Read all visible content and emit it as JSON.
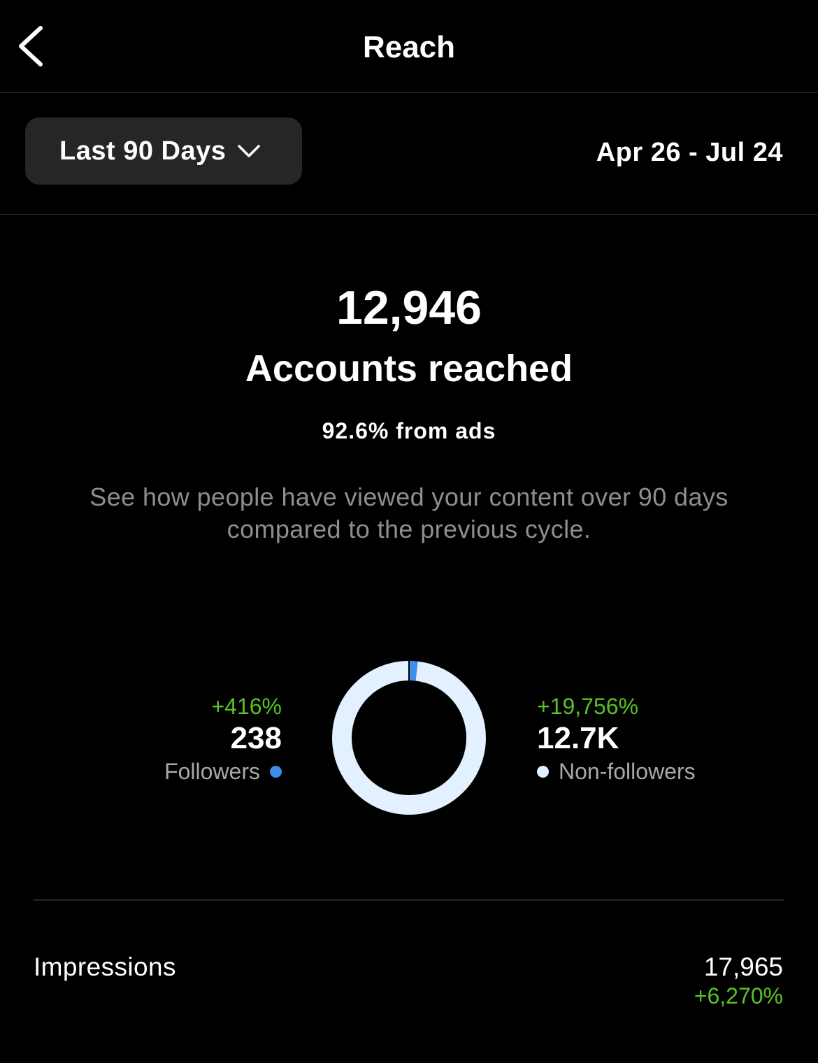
{
  "header": {
    "title": "Reach",
    "back_icon": "chevron-left-icon"
  },
  "range": {
    "selected": "Last 90 Days",
    "dropdown_icon": "chevron-down-icon",
    "dates": "Apr 26 - Jul 24"
  },
  "summary": {
    "total": "12,946",
    "label": "Accounts reached",
    "ads_share": "92.6% from ads",
    "description": "See how people have viewed your content over 90 days compared to the previous cycle."
  },
  "breakdown": {
    "followers": {
      "change": "+416%",
      "value": "238",
      "label": "Followers",
      "color": "#3b8eea"
    },
    "non_followers": {
      "change": "+19,756%",
      "value": "12.7K",
      "label": "Non-followers",
      "color": "#e3f0ff"
    }
  },
  "chart_data": {
    "type": "pie",
    "variant": "donut",
    "categories": [
      "Followers",
      "Non-followers"
    ],
    "values": [
      238,
      12708
    ],
    "colors": [
      "#3b8eea",
      "#e3f0ff"
    ]
  },
  "metrics": [
    {
      "label": "Impressions",
      "value": "17,965",
      "change": "+6,270%"
    }
  ],
  "colors": {
    "background": "#000000",
    "positive_change": "#58c322",
    "secondary_text": "#8e8e8e",
    "divider": "#262626"
  }
}
